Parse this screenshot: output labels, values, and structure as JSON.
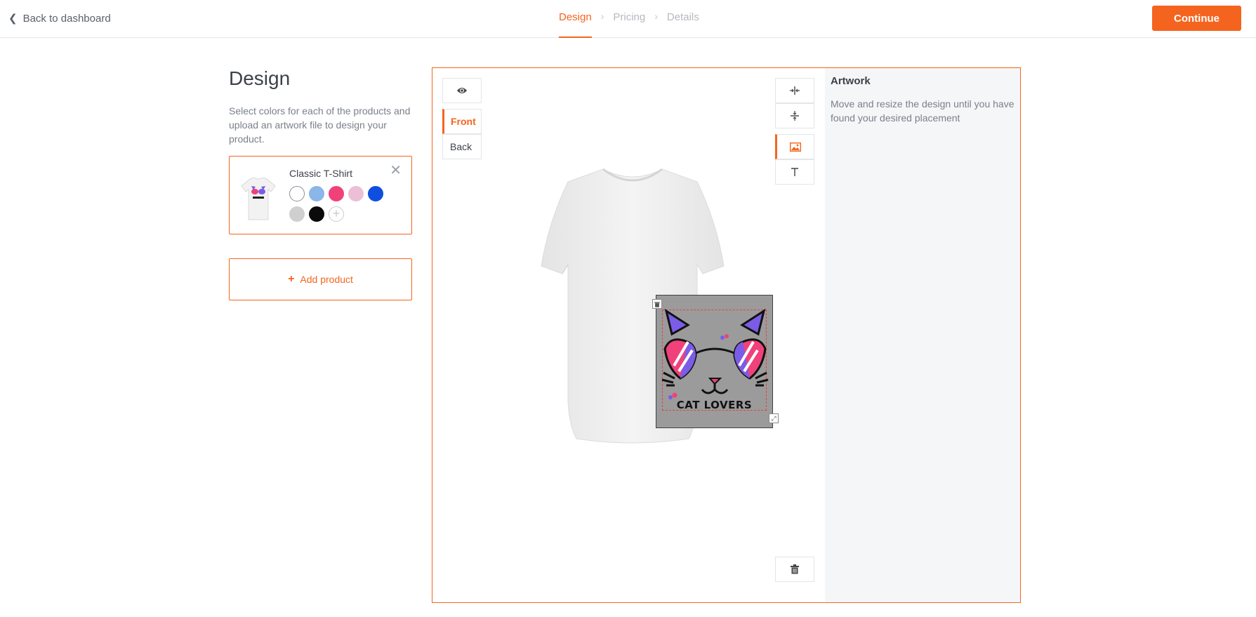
{
  "header": {
    "back_label": "Back to dashboard",
    "steps": [
      "Design",
      "Pricing",
      "Details"
    ],
    "active_step": 0,
    "continue_label": "Continue",
    "accent_color": "#f5641e"
  },
  "left": {
    "title": "Design",
    "description": "Select colors for each of the products and upload an artwork file to design your product.",
    "product": {
      "name": "Classic T-Shirt",
      "colors": [
        "#ffffff",
        "#8ab6e8",
        "#f0417a",
        "#ebbfd6",
        "#0f4fe0",
        "#cfcfcf",
        "#0b0b0b"
      ]
    },
    "add_product_label": "Add product"
  },
  "editor": {
    "sides": [
      "Front",
      "Back"
    ],
    "active_side": "Front",
    "tools": [
      "eye-icon",
      "align-horizontal-center-icon",
      "align-vertical-center-icon",
      "image-icon",
      "text-icon",
      "trash-icon"
    ],
    "artwork_text": "CAT LOVERS",
    "panel": {
      "title": "Artwork",
      "description": "Move and resize the design until you have found your desired placement"
    }
  }
}
